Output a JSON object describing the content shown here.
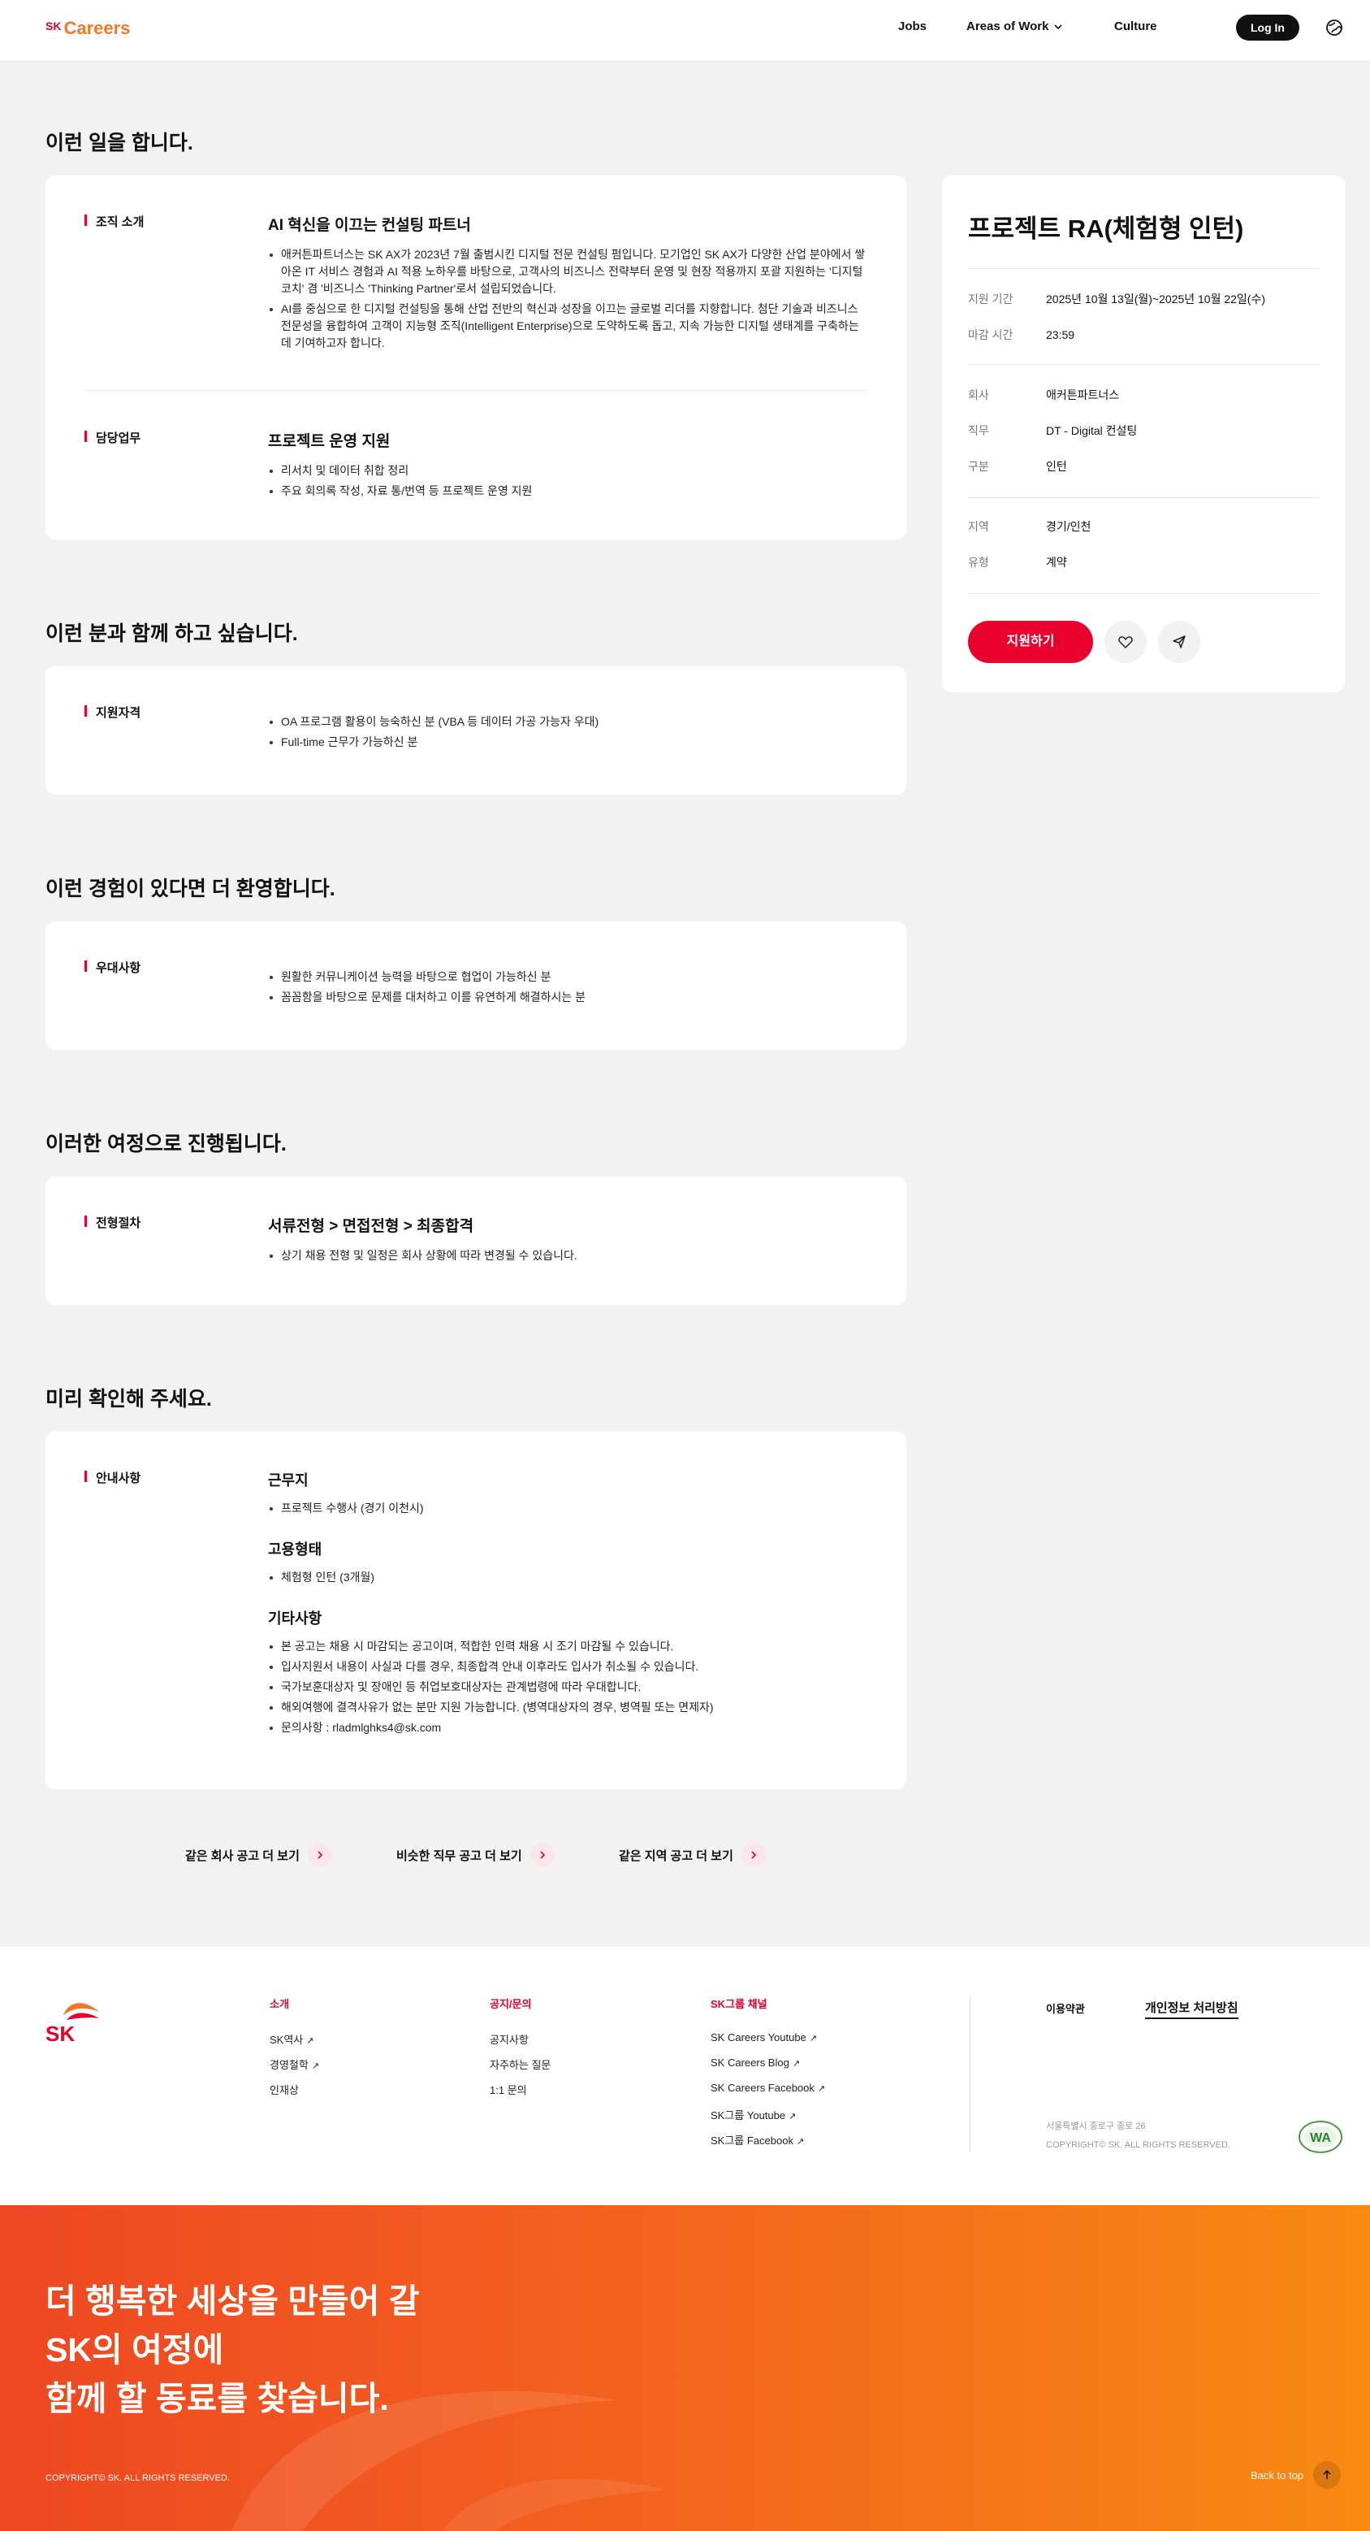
{
  "header": {
    "logo_sk": "SK",
    "logo_careers": "Careers",
    "nav": {
      "jobs": "Jobs",
      "areas": "Areas of Work",
      "culture": "Culture"
    },
    "login": "Log In"
  },
  "sections": {
    "s1": "이런 일을 합니다.",
    "s2": "이런 분과 함께 하고 싶습니다.",
    "s3": "이런 경험이 있다면 더 환영합니다.",
    "s4": "이러한 여정으로 진행됩니다.",
    "s5": "미리 확인해 주세요."
  },
  "org": {
    "label": "조직 소개",
    "head": "AI 혁신을 이끄는 컨설팅 파트너",
    "items": [
      "애커튼파트너스는 SK AX가 2023년 7월 출범시킨 디지털 전문 컨설팅 펌입니다. 모기업인 SK AX가 다양한 산업 분야에서 쌓아온 IT 서비스 경험과 AI 적용 노하우를 바탕으로, 고객사의 비즈니스 전략부터 운영 및 현장 적용까지 포괄 지원하는 '디지털 코치' 겸 '비즈니스 'Thinking Partner'로서 설립되었습니다.",
      "AI를 중심으로 한 디지털 컨설팅을 통해 산업 전반의 혁신과 성장을 이끄는 글로벌 리더를 지향합니다. 첨단 기술과 비즈니스 전문성을 융합하여 고객이 지능형 조직(Intelligent Enterprise)으로 도약하도록 돕고, 지속 가능한 디지털 생태계를 구축하는 데 기여하고자 합니다."
    ]
  },
  "duty": {
    "label": "담당업무",
    "head": "프로젝트 운영 지원",
    "items": [
      "리서치 및 데이터 취합 정리",
      "주요 회의록 작성, 자료 통/번역 등 프로젝트 운영 지원"
    ]
  },
  "qual": {
    "label": "지원자격",
    "items": [
      "OA 프로그램 활용이 능숙하신 분 (VBA 등 데이터 가공 가능자 우대)",
      "Full-time 근무가 가능하신 분"
    ]
  },
  "pref": {
    "label": "우대사항",
    "items": [
      "원활한 커뮤니케이션 능력을 바탕으로 협업이 가능하신 분",
      "꼼꼼함을 바탕으로 문제를 대처하고 이를 유연하게 해결하시는 분"
    ]
  },
  "process": {
    "label": "전형절차",
    "head": "서류전형 > 면접전형 > 최종합격",
    "items": [
      "상기 채용 전형 및 일정은 회사 상황에 따라 변경될 수 있습니다."
    ]
  },
  "notice": {
    "label": "안내사항",
    "work_head": "근무지",
    "work_items": [
      "프로젝트 수행사 (경기 이천시)"
    ],
    "emp_head": "고용형태",
    "emp_items": [
      "체험형 인턴 (3개월)"
    ],
    "etc_head": "기타사항",
    "etc_items": [
      "본 공고는 채용 시 마감되는 공고이며, 적합한 인력 채용 시 조기 마감될 수 있습니다.",
      "입사지원서 내용이 사실과 다를 경우, 최종합격 안내 이후라도 입사가 취소될 수 있습니다.",
      "국가보훈대상자 및 장애인 등 취업보호대상자는 관계법령에 따라 우대합니다.",
      "해외여행에 결격사유가 없는 분만 지원 가능합니다. (병역대상자의 경우, 병역필 또는 면제자)",
      "문의사항 : rladmlghks4@sk.com"
    ]
  },
  "more": {
    "company": "같은 회사 공고 더 보기",
    "job": "비슷한 직무 공고 더 보기",
    "region": "같은 지역 공고 더 보기"
  },
  "side": {
    "title": "프로젝트 RA(체험형 인턴)",
    "period_k": "지원 기간",
    "period_v": "2025년 10월 13일(월)~2025년 10월 22일(수)",
    "deadline_k": "마감 시간",
    "deadline_v": "23:59",
    "company_k": "회사",
    "company_v": "애커튼파트너스",
    "job_k": "직무",
    "job_v": "DT - Digital 컨설팅",
    "type_k": "구분",
    "type_v": "인턴",
    "region_k": "지역",
    "region_v": "경기/인천",
    "contract_k": "유형",
    "contract_v": "계약",
    "apply": "지원하기"
  },
  "footer": {
    "col1_head": "소개",
    "col1": [
      "SK역사",
      "경영철학",
      "인재상"
    ],
    "col2_head": "공지/문의",
    "col2": [
      "공지사항",
      "자주하는 질문",
      "1:1 문의"
    ],
    "col3_head": "SK그룹 채널",
    "col3": [
      "SK Careers Youtube",
      "SK Careers Blog",
      "SK Careers Facebook",
      "SK그룹 Youtube",
      "SK그룹 Facebook"
    ],
    "terms": "이용약관",
    "privacy": "개인정보 처리방침",
    "address": "서울특별시 종로구 종로 26",
    "copyright": "COPYRIGHT© SK. ALL RIGHTS RESERVED.",
    "badge": "WA"
  },
  "banner": {
    "line1": "더 행복한 세상을 만들어 갈",
    "line2": "SK의 여정에",
    "line3": "함께 할 동료를 찾습니다.",
    "copyright": "COPYRIGHT© SK. ALL RIGHTS RESERVED.",
    "back_to_top": "Back to top"
  },
  "colors": {
    "brand_red": "#ea002c",
    "brand_orange": "#f47725"
  }
}
